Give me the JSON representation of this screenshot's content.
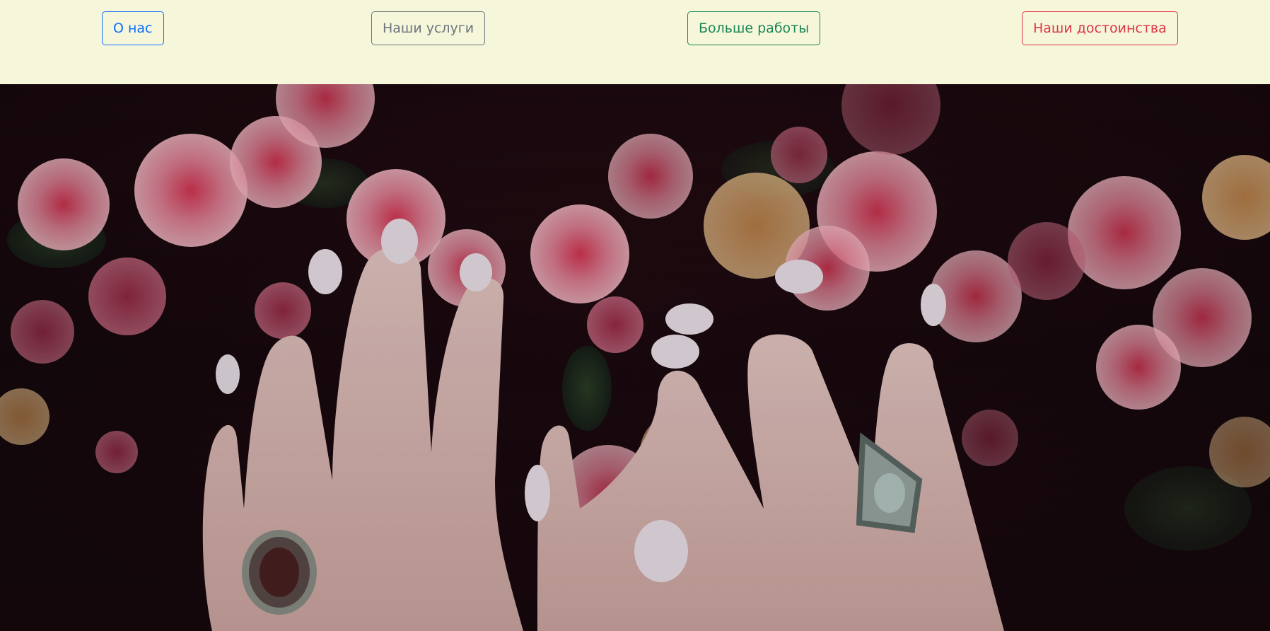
{
  "nav": {
    "about_label": "О нас",
    "services_label": "Наши услуги",
    "work_label": "Больше работы",
    "merits_label": "Наши достоинства"
  },
  "colors": {
    "topbar_bg": "#f6f6da",
    "about": "#0d6efd",
    "services": "#6c757d",
    "work": "#198754",
    "merits": "#dc3545"
  },
  "hero": {
    "image_subject": "hands with white manicured nails and silver rings among pink azalea flowers"
  }
}
